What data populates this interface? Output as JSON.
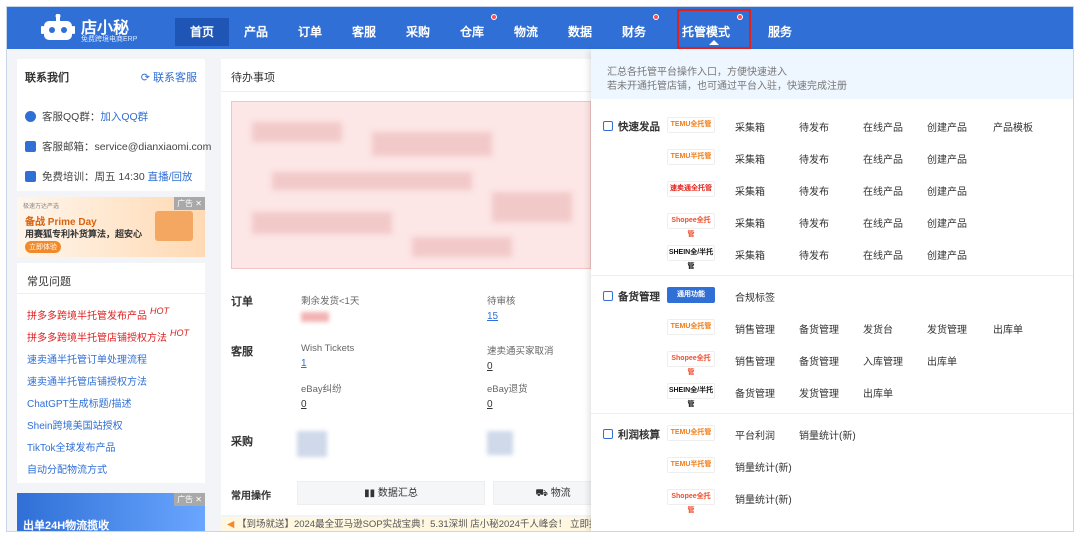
{
  "app": {
    "name": "店小秘",
    "slogan": "免费跨境电商ERP"
  },
  "nav": {
    "items": [
      {
        "label": "首页",
        "active": true
      },
      {
        "label": "产品"
      },
      {
        "label": "订单"
      },
      {
        "label": "客服"
      },
      {
        "label": "采购"
      },
      {
        "label": "仓库",
        "dot": true
      },
      {
        "label": "物流"
      },
      {
        "label": "数据"
      },
      {
        "label": "财务",
        "dot": true
      },
      {
        "label": "托管模式",
        "dot": true,
        "highlighted": true
      },
      {
        "label": "服务"
      }
    ]
  },
  "contact": {
    "title": "联系我们",
    "service_link": "联系客服",
    "qq_label": "客服QQ群：",
    "qq_link": "加入QQ群",
    "email_label": "客服邮箱：",
    "email": "service@dianxiaomi.com",
    "training_label": "免费培训：周五 14:30",
    "training_link": "直播/回放"
  },
  "ad1": {
    "tag": "广告",
    "brand": "极速万达严选",
    "line1": "备战 Prime Day",
    "line2": "用赛狐专利补货算法，超安心",
    "cta": "立即体验"
  },
  "faq": {
    "title": "常见问题",
    "items": [
      {
        "text": "拼多多跨境半托管发布产品",
        "hot": "HOT",
        "red": true
      },
      {
        "text": "拼多多跨境半托管店铺授权方法",
        "hot": "HOT",
        "red": true
      },
      {
        "text": "速卖通半托管订单处理流程"
      },
      {
        "text": "速卖通半托管店铺授权方法"
      },
      {
        "text": "ChatGPT生成标题/描述"
      },
      {
        "text": "Shein跨境美国站授权"
      },
      {
        "text": "TikTok全球发布产品"
      },
      {
        "text": "自动分配物流方式"
      }
    ]
  },
  "ad2": {
    "tag": "广告",
    "text": "出单24H物流揽收"
  },
  "todo": {
    "title": "待办事项",
    "orders_label": "订单",
    "orders_stats": [
      {
        "label": "剩余发货<1天",
        "value": ""
      },
      {
        "label": "待审核",
        "value": "15"
      }
    ],
    "cs_label": "客服",
    "cs_stats": [
      {
        "label": "Wish Tickets",
        "value": "1"
      },
      {
        "label": "速卖通买家取消",
        "value": "0"
      },
      {
        "label": "eBay纠纷",
        "value": "0"
      },
      {
        "label": "eBay退货",
        "value": "0"
      }
    ],
    "purchase_label": "采购"
  },
  "ops": {
    "label": "常用操作",
    "buttons": [
      "数据汇总",
      "物流"
    ]
  },
  "marquee": "【到场就送】2024最全亚马逊SOP实战宝典！5.31深圳 店小秘2024千人峰会！ 立即报名",
  "dropdown": {
    "intro1": "汇总各托管平台操作入口，方便快速进入",
    "intro2": "若未开通托管店铺，也可通过平台入驻，快速完成注册",
    "groups": [
      {
        "title": "快速发品",
        "rows": [
          {
            "badge": "TEMU全托管",
            "links": [
              "采集箱",
              "待发布",
              "在线产品",
              "创建产品",
              "产品模板"
            ]
          },
          {
            "badge": "TEMU半托管",
            "links": [
              "采集箱",
              "待发布",
              "在线产品",
              "创建产品"
            ]
          },
          {
            "badge": "速卖通全托管",
            "links": [
              "采集箱",
              "待发布",
              "在线产品",
              "创建产品"
            ]
          },
          {
            "badge": "Shopee全托管",
            "links": [
              "采集箱",
              "待发布",
              "在线产品",
              "创建产品"
            ]
          },
          {
            "badge": "SHEIN全/半托管",
            "links": [
              "采集箱",
              "待发布",
              "在线产品",
              "创建产品"
            ]
          }
        ]
      },
      {
        "title": "备货管理",
        "rows": [
          {
            "badge": "通用功能",
            "links": [
              "合规标签"
            ]
          },
          {
            "badge": "TEMU全托管",
            "links": [
              "销售管理",
              "备货管理",
              "发货台",
              "发货管理",
              "出库单"
            ]
          },
          {
            "badge": "Shopee全托管",
            "links": [
              "销售管理",
              "备货管理",
              "入库管理",
              "出库单"
            ]
          },
          {
            "badge": "SHEIN全/半托管",
            "links": [
              "备货管理",
              "发货管理",
              "出库单"
            ]
          }
        ]
      },
      {
        "title": "利润核算",
        "rows": [
          {
            "badge": "TEMU全托管",
            "links": [
              "平台利润",
              "销量统计(新)"
            ]
          },
          {
            "badge": "TEMU半托管",
            "links": [
              "销量统计(新)"
            ]
          },
          {
            "badge": "Shopee全托管",
            "links": [
              "销量统计(新)"
            ]
          }
        ]
      }
    ]
  }
}
